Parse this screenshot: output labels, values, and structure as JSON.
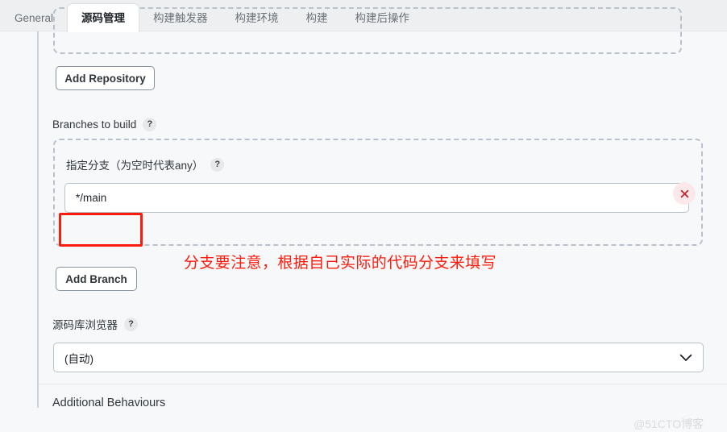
{
  "tabs": [
    {
      "label": "General",
      "active": false
    },
    {
      "label": "源码管理",
      "active": true
    },
    {
      "label": "构建触发器",
      "active": false
    },
    {
      "label": "构建环境",
      "active": false
    },
    {
      "label": "构建",
      "active": false
    },
    {
      "label": "构建后操作",
      "active": false
    }
  ],
  "buttons": {
    "add_repository": "Add Repository",
    "add_branch": "Add Branch"
  },
  "labels": {
    "branches_to_build": "Branches to build",
    "repo_browser": "源码库浏览器",
    "branch_specifier": "指定分支（为空时代表any）",
    "help_glyph": "?",
    "additional_behaviours": "Additional Behaviours"
  },
  "inputs": {
    "branch_value": "*/main",
    "branch_placeholder": ""
  },
  "select": {
    "repo_browser_value": "(自动)"
  },
  "annotation": {
    "note": "分支要注意，根据自己实际的代码分支来填写",
    "color": "#fc1b0c"
  },
  "icons": {
    "close": "close-icon",
    "chevron": "chevron-down-icon"
  },
  "watermark": "@51CTO博客",
  "colors": {
    "page_bg": "#f7f8f9",
    "tabbar_bg": "#eeeff0",
    "dashed_border": "#b9c2cc",
    "input_border": "#b7c2cd",
    "close_chip_bg": "#fae8ea",
    "close_glyph": "#c8202a"
  }
}
